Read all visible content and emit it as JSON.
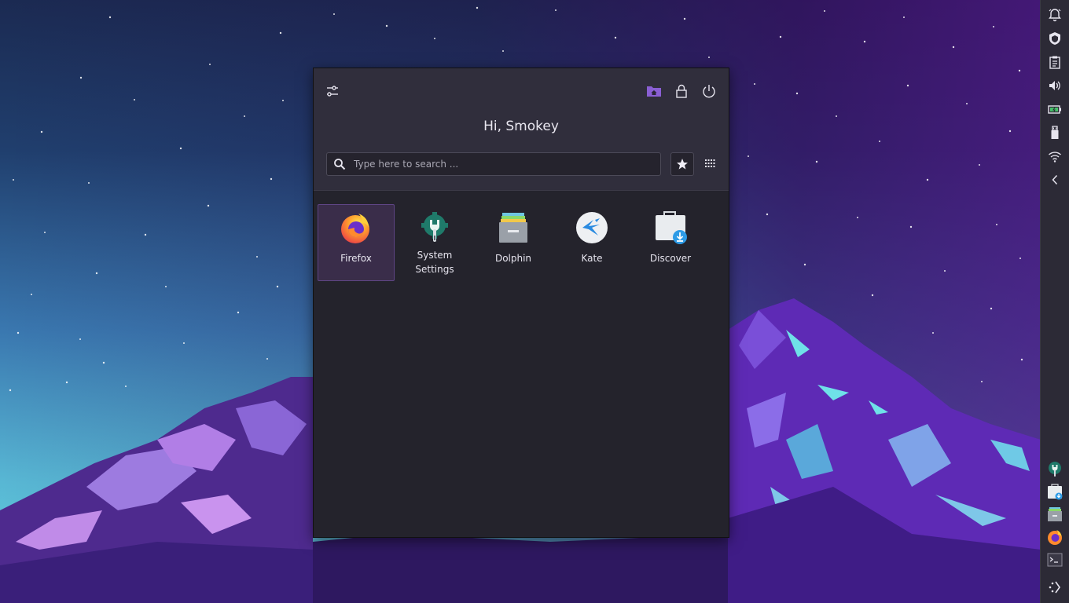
{
  "launcher": {
    "greeting": "Hi, Smokey",
    "search_placeholder": "Type here to search ...",
    "header_icons": {
      "configure": "configure-icon",
      "home_folder": "home-folder-icon",
      "lock": "lock-icon",
      "power": "power-icon"
    },
    "toolbar_icons": {
      "favorites": "star-icon",
      "all_apps": "grid-icon"
    },
    "apps": [
      {
        "label": "Firefox",
        "icon": "firefox-icon",
        "selected": true
      },
      {
        "label": "System Settings",
        "icon": "system-settings-icon",
        "selected": false
      },
      {
        "label": "Dolphin",
        "icon": "dolphin-icon",
        "selected": false
      },
      {
        "label": "Kate",
        "icon": "kate-icon",
        "selected": false
      },
      {
        "label": "Discover",
        "icon": "discover-icon",
        "selected": false
      }
    ]
  },
  "panel": {
    "tray_icons": [
      "notifications-icon",
      "vault-icon",
      "clipboard-icon",
      "volume-icon",
      "battery-icon",
      "usb-icon",
      "wifi-icon",
      "expand-arrow-icon"
    ],
    "task_icons": [
      "system-settings-icon",
      "discover-icon",
      "dolphin-icon",
      "firefox-icon",
      "terminal-icon",
      "app-launcher-icon"
    ]
  },
  "colors": {
    "accent": "#7a4fc0",
    "launcher_bg": "#24232c",
    "launcher_header_bg": "#302e3c",
    "panel_bg": "#2c2a36"
  }
}
